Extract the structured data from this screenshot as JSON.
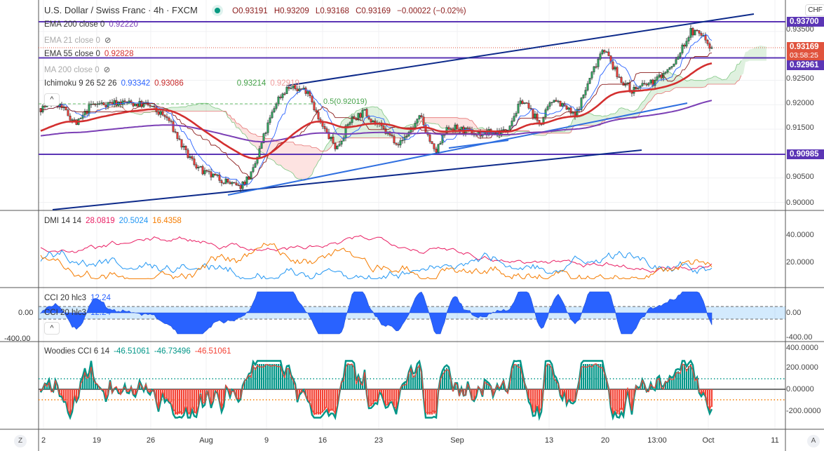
{
  "header": {
    "symbol": "U.S. Dollar / Swiss Franc · 4h · FXCM",
    "open": "O0.93191",
    "high": "H0.93209",
    "low": "L0.93168",
    "close": "C0.93169",
    "change": "−0.00022 (−0.02%)"
  },
  "legend": {
    "ema200": {
      "label": "EMA 200 close 0",
      "value": "0.92220"
    },
    "ema21": {
      "label": "EMA 21 close 0"
    },
    "ema55": {
      "label": "EMA 55 close 0",
      "value": "0.92828"
    },
    "ma200": {
      "label": "MA 200 close 0"
    },
    "ichimoku": {
      "label": "Ichimoku 9 26 52 26",
      "v1": "0.93342",
      "v2": "0.93086",
      "v3": "0.93214",
      "v4": "0.92919"
    },
    "dmi": {
      "label": "DMI 14 14",
      "v1": "28.0819",
      "v2": "20.5024",
      "v3": "16.4358"
    },
    "cci": {
      "label": "CCI 20 hlc3",
      "value": "12.24"
    },
    "woodies": {
      "label": "Woodies CCI 6 14",
      "v1": "-46.51061",
      "v2": "-46.73496",
      "v3": "-46.51061"
    }
  },
  "fib_label": "0.5(0.92019)",
  "currency": "CHF",
  "price_axis": [
    "0.93500",
    "0.92500",
    "0.92000",
    "0.91500",
    "0.90500",
    "0.90000"
  ],
  "price_tags": {
    "upper": "0.93700",
    "last": "0.93169",
    "countdown": "03:58:25",
    "mid": "0.92961",
    "lower": "0.90985"
  },
  "dmi_axis": [
    "40.0000",
    "20.0000"
  ],
  "cci_axis": {
    "right": [
      "0.00",
      "-400.00"
    ],
    "left": [
      "0.00",
      "-400.00"
    ]
  },
  "woodies_axis": [
    "400.0000",
    "200.0000",
    "0.00000",
    "-200.0000"
  ],
  "time_axis": [
    "2",
    "19",
    "26",
    "Aug",
    "9",
    "16",
    "23",
    "Sep",
    "13",
    "20",
    "13:00",
    "Oct",
    "11"
  ],
  "buttons": {
    "z": "Z",
    "a": "A",
    "collapse": "^"
  },
  "colors": {
    "up": "#2e9e5b",
    "down": "#e53935",
    "ema55": "#d32f2f",
    "ema200": "#7b3fb5",
    "level": "#5b35b5",
    "last": "#e0533d"
  },
  "chart_data": {
    "type": "candlestick",
    "title": "U.S. Dollar / Swiss Franc · 4h · FXCM",
    "x_labels": [
      "2",
      "19",
      "26",
      "Aug",
      "9",
      "16",
      "23",
      "Sep",
      "13",
      "20",
      "13:00",
      "Oct",
      "11"
    ],
    "ylim": [
      0.8985,
      0.9385
    ],
    "approx_close_path": [
      [
        "Jul 12",
        0.9195
      ],
      [
        "Jul 15",
        0.9205
      ],
      [
        "Jul 17",
        0.916
      ],
      [
        "Jul 19",
        0.92
      ],
      [
        "Jul 22",
        0.9205
      ],
      [
        "Jul 26",
        0.92
      ],
      [
        "Jul 28",
        0.917
      ],
      [
        "Jul 30",
        0.91
      ],
      [
        "Aug 2",
        0.906
      ],
      [
        "Aug 4",
        0.9045
      ],
      [
        "Aug 6",
        0.903
      ],
      [
        "Aug 8",
        0.906
      ],
      [
        "Aug 9",
        0.913
      ],
      [
        "Aug 11",
        0.921
      ],
      [
        "Aug 12",
        0.9235
      ],
      [
        "Aug 15",
        0.923
      ],
      [
        "Aug 16",
        0.9165
      ],
      [
        "Aug 18",
        0.911
      ],
      [
        "Aug 20",
        0.917
      ],
      [
        "Aug 22",
        0.9185
      ],
      [
        "Aug 24",
        0.915
      ],
      [
        "Aug 27",
        0.912
      ],
      [
        "Aug 30",
        0.9175
      ],
      [
        "Sep 1",
        0.91
      ],
      [
        "Sep 2",
        0.9155
      ],
      [
        "Sep 6",
        0.914
      ],
      [
        "Sep 9",
        0.9145
      ],
      [
        "Sep 11",
        0.921
      ],
      [
        "Sep 13",
        0.916
      ],
      [
        "Sep 15",
        0.9215
      ],
      [
        "Sep 17",
        0.9175
      ],
      [
        "Sep 18",
        0.925
      ],
      [
        "Sep 20",
        0.932
      ],
      [
        "Sep 22",
        0.926
      ],
      [
        "Sep 24",
        0.923
      ],
      [
        "Sep 27",
        0.9245
      ],
      [
        "Sep 28",
        0.928
      ],
      [
        "Sep 30",
        0.935
      ],
      [
        "Oct 1",
        0.9345
      ],
      [
        "Oct 1 last",
        0.93169
      ]
    ],
    "levels": [
      0.937,
      0.92961,
      0.90985
    ],
    "fib_50": 0.92019
  }
}
